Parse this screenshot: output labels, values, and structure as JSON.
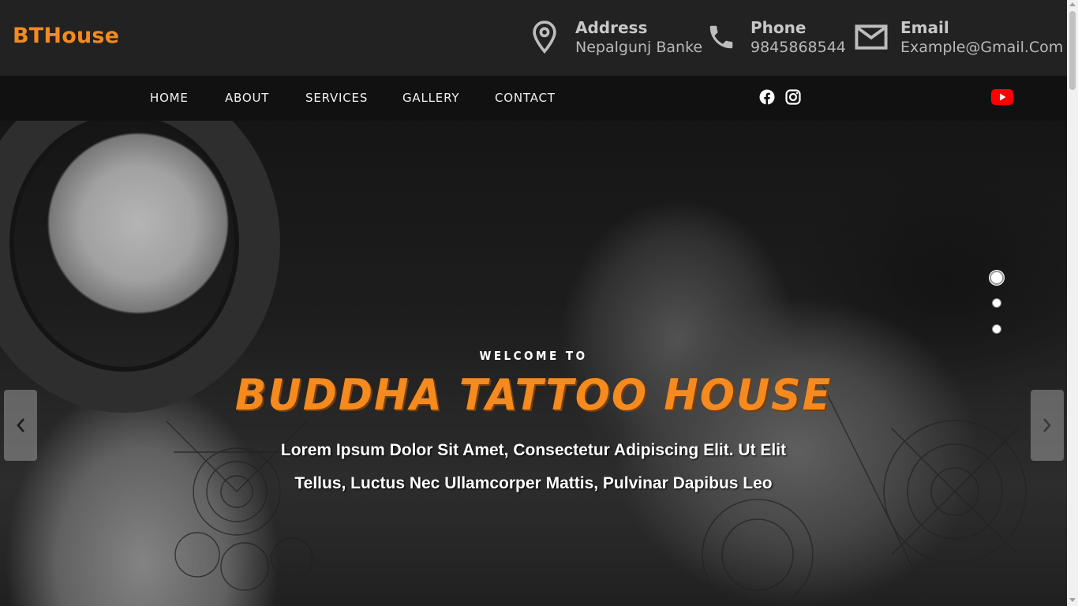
{
  "header": {
    "brand": "BTHouse",
    "address": {
      "label": "Address",
      "value": "Nepalgunj Banke",
      "icon": "map-pin-icon"
    },
    "phone": {
      "label": "Phone",
      "value": "9845868544",
      "icon": "phone-icon"
    },
    "email": {
      "label": "Email",
      "value": "Example@Gmail.Com",
      "icon": "envelope-icon"
    }
  },
  "nav": {
    "items": [
      "HOME",
      "ABOUT",
      "SERVICES",
      "GALLERY",
      "CONTACT"
    ],
    "social": [
      "facebook-icon",
      "instagram-icon",
      "youtube-icon"
    ]
  },
  "hero": {
    "subtitle": "WELCOME TO",
    "title": "BUDDHA TATTOO HOUSE",
    "description": "Lorem Ipsum Dolor Sit Amet, Consectetur Adipiscing Elit. Ut Elit Tellus, Luctus Nec Ullamcorper Mattis, Pulvinar Dapibus Leo",
    "slides": 3,
    "active_slide": 1
  },
  "colors": {
    "accent": "#f58a1f",
    "topbar_bg": "#222222",
    "navbar_bg": "#111111",
    "youtube_red": "#ff0000"
  }
}
